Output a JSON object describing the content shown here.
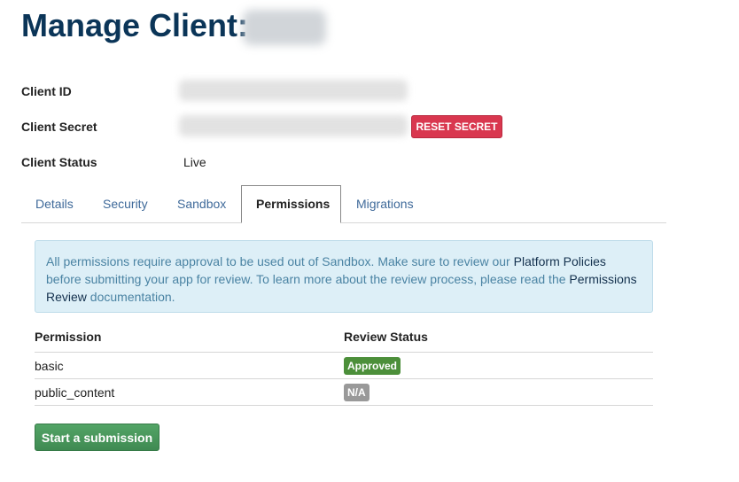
{
  "header": {
    "title": "Manage Client:"
  },
  "client": {
    "id_label": "Client ID",
    "secret_label": "Client Secret",
    "reset_secret_label": "RESET SECRET",
    "status_label": "Client Status",
    "status_value": "Live"
  },
  "tabs": [
    {
      "label": "Details",
      "active": false
    },
    {
      "label": "Security",
      "active": false
    },
    {
      "label": "Sandbox",
      "active": false
    },
    {
      "label": "Permissions",
      "active": true
    },
    {
      "label": "Migrations",
      "active": false
    }
  ],
  "notice": {
    "text_1": "All permissions require approval to be used out of Sandbox. Make sure to review our ",
    "link_1": "Platform Policies",
    "text_2": " before submitting your app for review. To learn more about the review process, please read the ",
    "link_2": "Permissions Review",
    "text_3": " documentation."
  },
  "permissions_table": {
    "headers": [
      "Permission",
      "Review Status"
    ],
    "rows": [
      {
        "permission": "basic",
        "status": "Approved",
        "status_color": "#4c8f3a"
      },
      {
        "permission": "public_content",
        "status": "N/A",
        "status_color": "#999999"
      }
    ]
  },
  "actions": {
    "submit_label": "Start a submission"
  },
  "colors": {
    "title": "#0b3558",
    "link": "#3f6a9a",
    "danger": "#d9374f",
    "success": "#4c8f3a",
    "notice_bg": "#ddeff7"
  }
}
